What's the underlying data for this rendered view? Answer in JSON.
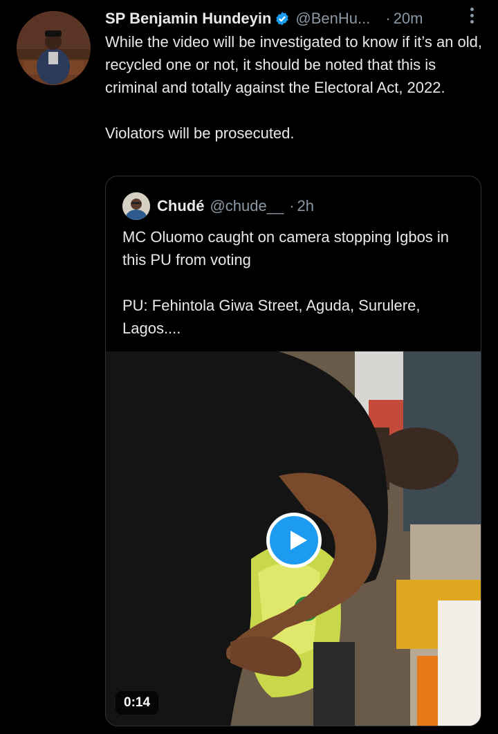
{
  "tweet": {
    "author_name": "SP Benjamin Hundeyin",
    "handle": "@BenHu...",
    "separator": "·",
    "time": "20m",
    "text": "While the video will be investigated to know if it’s an old, recycled one or not, it should be noted that this is criminal and totally against the Electoral Act, 2022.\n\nViolators will be prosecuted."
  },
  "quoted": {
    "author_name": "Chudé",
    "handle": "@chude__",
    "separator": "·",
    "time": "2h",
    "text": "MC Oluomo caught on camera stopping Igbos in this PU from voting\n\nPU: Fehintola Giwa Street, Aguda, Surulere, Lagos....",
    "video_duration": "0:14"
  },
  "colors": {
    "background": "#000000",
    "text_primary": "#e7e9ea",
    "text_secondary": "#8b98a5",
    "accent": "#1d9bf0",
    "border": "#2f3336"
  },
  "icons": [
    "verified-badge-icon",
    "more-options-icon",
    "play-icon"
  ]
}
